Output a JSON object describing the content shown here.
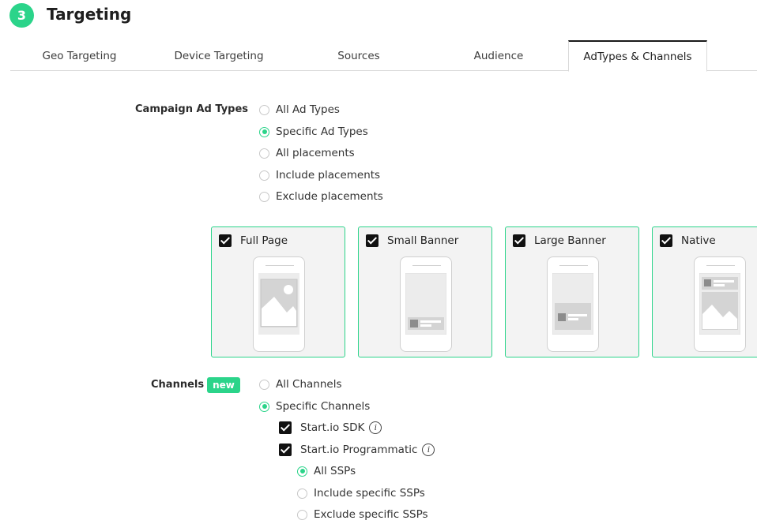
{
  "section": {
    "step": "3",
    "title": "Targeting"
  },
  "tabs": [
    {
      "label": "Geo Targeting"
    },
    {
      "label": "Device Targeting"
    },
    {
      "label": "Sources"
    },
    {
      "label": "Audience"
    },
    {
      "label": "AdTypes & Channels",
      "active": true
    }
  ],
  "ad_types": {
    "label": "Campaign Ad Types",
    "options": [
      {
        "label": "All Ad Types",
        "selected": false
      },
      {
        "label": "Specific Ad Types",
        "selected": true
      },
      {
        "label": "All placements",
        "selected": false
      },
      {
        "label": "Include placements",
        "selected": false
      },
      {
        "label": "Exclude placements",
        "selected": false
      }
    ],
    "cards": [
      {
        "label": "Full Page",
        "checked": true,
        "icon": "full-page-ad-icon"
      },
      {
        "label": "Small Banner",
        "checked": true,
        "icon": "small-banner-ad-icon"
      },
      {
        "label": "Large Banner",
        "checked": true,
        "icon": "large-banner-ad-icon"
      },
      {
        "label": "Native",
        "checked": true,
        "icon": "native-ad-icon"
      }
    ]
  },
  "channels": {
    "label": "Channels",
    "badge": "new",
    "options": [
      {
        "label": "All Channels",
        "selected": false
      },
      {
        "label": "Specific Channels",
        "selected": true
      }
    ],
    "sub_channels": [
      {
        "label": "Start.io SDK",
        "checked": true
      },
      {
        "label": "Start.io Programmatic",
        "checked": true
      }
    ],
    "ssp_options": [
      {
        "label": "All SSPs",
        "selected": true
      },
      {
        "label": "Include specific SSPs",
        "selected": false
      },
      {
        "label": "Exclude specific SSPs",
        "selected": false
      }
    ]
  },
  "colors": {
    "accent": "#2bd48a",
    "card_bg": "#f3f3f3",
    "text": "#2b2b2b"
  },
  "info_glyph": "i"
}
